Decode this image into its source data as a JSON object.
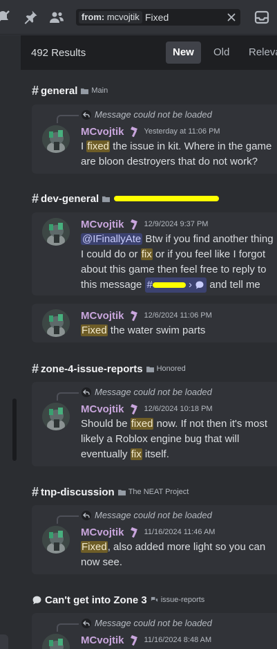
{
  "search": {
    "filter_key": "from:",
    "filter_value": "mcvojtik",
    "query": "Fixed"
  },
  "toolbar": {
    "icons": [
      "mute-icon",
      "pin-icon",
      "members-icon",
      "inbox-icon",
      "clear-icon"
    ]
  },
  "results": {
    "count_label": "492 Results",
    "sort_tabs": [
      "New",
      "Old",
      "Relevant"
    ],
    "active_tab": "New"
  },
  "groups": [
    {
      "channel": "general",
      "category": "Main",
      "channel_type": "text",
      "messages": [
        {
          "reply_label": "Message could not be loaded",
          "author": "MCvojtik",
          "timestamp": "Yesterday at 11:06 PM",
          "lines": [
            [
              {
                "t": "I "
              },
              {
                "t": "fixed",
                "hl": true
              },
              {
                "t": " the issue in kit. Where in the game"
              }
            ],
            [
              {
                "t": "are bloon destroyers that do not work?"
              }
            ]
          ]
        }
      ]
    },
    {
      "channel": "dev-general",
      "category": "",
      "category_redacted": true,
      "channel_type": "text",
      "messages": [
        {
          "author": "MCvojtik",
          "timestamp": "12/9/2024 9:37 PM",
          "lines": [
            [
              {
                "t": "@IFinallyAte",
                "mention": true
              },
              {
                "t": " Btw if you find another thing"
              }
            ],
            [
              {
                "t": "I could do or "
              },
              {
                "t": "fix",
                "hl": true
              },
              {
                "t": " or if you feel like I forgot"
              }
            ],
            [
              {
                "t": "about this game then feel free to reply to"
              }
            ],
            [
              {
                "t": "this message "
              },
              {
                "t": "#",
                "channel_mention": true
              },
              {
                "t": " and tell me"
              }
            ]
          ]
        },
        {
          "author": "MCvojtik",
          "timestamp": "12/6/2024 11:06 PM",
          "lines": [
            [
              {
                "t": "Fixed",
                "hl": true
              },
              {
                "t": " the water swim parts"
              }
            ]
          ]
        }
      ]
    },
    {
      "channel": "zone-4-issue-reports",
      "category": "Honored",
      "channel_type": "text",
      "messages": [
        {
          "reply_label": "Message could not be loaded",
          "author": "MCvojtik",
          "timestamp": "12/6/2024 10:18 PM",
          "lines": [
            [
              {
                "t": "Should be "
              },
              {
                "t": "fixed",
                "hl": true
              },
              {
                "t": " now. If not then it's most"
              }
            ],
            [
              {
                "t": "likely a Roblox engine bug that will"
              }
            ],
            [
              {
                "t": "eventually "
              },
              {
                "t": "fix",
                "hl": true
              },
              {
                "t": " itself."
              }
            ]
          ]
        }
      ]
    },
    {
      "channel": "tnp-discussion",
      "category": "The NEAT Project",
      "channel_type": "text",
      "messages": [
        {
          "reply_label": "Message could not be loaded",
          "author": "MCvojtik",
          "timestamp": "11/16/2024 11:46 AM",
          "lines": [
            [
              {
                "t": "Fixed",
                "hl": true
              },
              {
                "t": ", also added more light so you can"
              }
            ],
            [
              {
                "t": "now see."
              }
            ]
          ]
        }
      ]
    },
    {
      "channel": "Can't get into Zone 3",
      "category": "issue-reports",
      "channel_type": "thread",
      "messages": [
        {
          "reply_label": "Message could not be loaded",
          "author": "MCvojtik",
          "timestamp": "11/16/2024 8:48 AM",
          "lines": []
        }
      ]
    }
  ]
}
